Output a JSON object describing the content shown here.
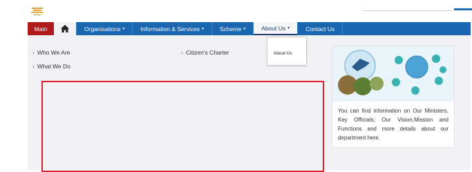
{
  "header": {
    "logo": "national-emblem",
    "search_placeholder": ""
  },
  "nav": {
    "main": "Main",
    "home_icon": "home-icon",
    "items": [
      {
        "label": "Organisations",
        "has_caret": true
      },
      {
        "label": "Information & Services",
        "has_caret": true
      },
      {
        "label": "Scheme",
        "has_caret": true
      },
      {
        "label": "About Us",
        "has_caret": true,
        "active": true
      },
      {
        "label": "Contact Us",
        "has_caret": false
      }
    ],
    "caret_glyph": "▾"
  },
  "dropdown": {
    "items": [
      "About Us"
    ]
  },
  "content": {
    "links_left": [
      "Who We Are",
      "What We Do"
    ],
    "links_right": [
      "Citizen's Charter"
    ],
    "chevron": "›"
  },
  "card": {
    "text": "You can find information on Our Ministers, Key Officials, Our Vision,Mission and Functions and more details about our department here."
  },
  "colors": {
    "nav_blue": "#1b66b1",
    "main_red": "#b01b1b",
    "highlight_red": "#d9232d",
    "content_bg": "#f1f1f6"
  }
}
